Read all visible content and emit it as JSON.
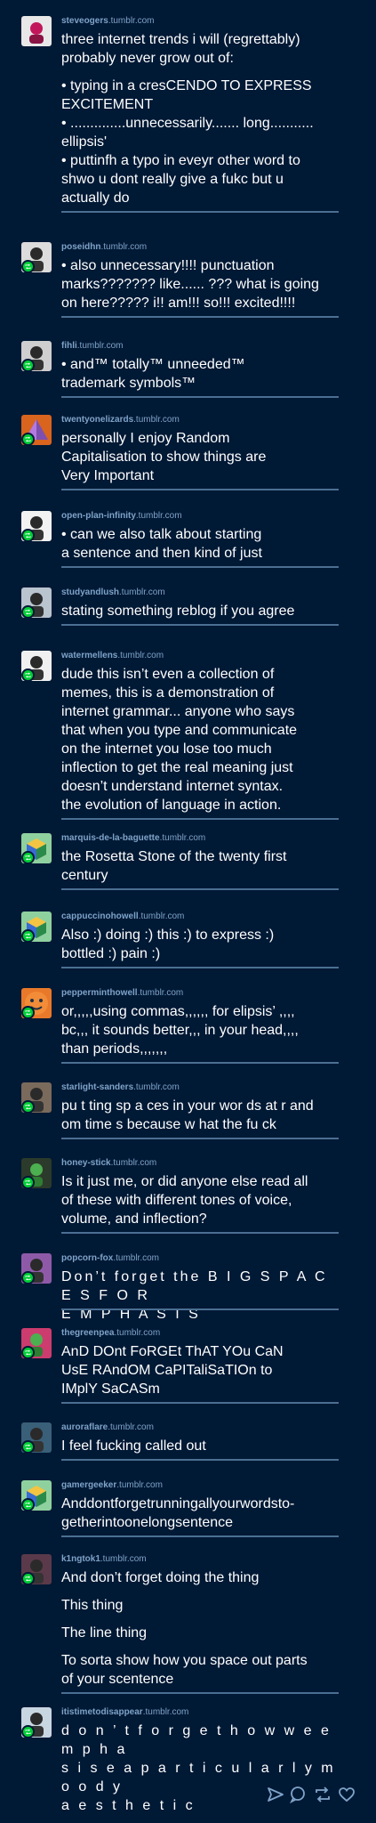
{
  "colors": {
    "background": "#001935",
    "username": "#7fa3c9",
    "text": "#ffffff",
    "separator": "#4b6f92",
    "reblog_badge": "#00cf35",
    "toolbar_icon": "#7fa3c9"
  },
  "posts": [
    {
      "user": "steveogers",
      "lines": [
        "three internet trends i will (regrettably)",
        "probably never grow out of:",
        "",
        "• typing in a cresCENDO TO EXPRESS",
        "EXCITEMENT",
        "• ..............unnecessarily....... long...........",
        "ellipsis'",
        "• puttinfh a typo in eveyr other word to",
        "shwo u dont really give a fukc but u",
        "actually do"
      ]
    },
    {
      "user": "poseidhn",
      "lines": [
        "• also unnecessary!!!! punctuation",
        "marks??????? like...... ??? what is going",
        "on here????? i!! am!!! so!!! excited!!!!"
      ]
    },
    {
      "user": "fihli",
      "lines": [
        "• and™ totally™ unneeded™",
        "trademark symbols™"
      ]
    },
    {
      "user": "twentyonelizards",
      "lines": [
        "personally I enjoy Random",
        "Capitalisation to show things are",
        "Very Important"
      ]
    },
    {
      "user": "open-plan-infinity",
      "lines": [
        "• can we also talk about starting",
        "a sentence and then kind of just"
      ]
    },
    {
      "user": "studyandlush",
      "lines": [
        "stating something reblog if you agree"
      ]
    },
    {
      "user": "watermellens",
      "lines": [
        "dude this isn’t even a collection of",
        "memes, this is a demonstration of",
        "internet grammar... anyone who says",
        "that when you type and communicate",
        "on the internet you lose too much",
        "inflection to get the real meaning just",
        "doesn’t understand internet syntax.",
        "the evolution of language in action."
      ]
    },
    {
      "user": "marquis-de-la-baguette",
      "lines": [
        "the Rosetta Stone of the twenty first",
        "century"
      ]
    },
    {
      "user": "cappuccinohowell",
      "lines": [
        "Also :) doing :) this :) to express :)",
        "bottled :) pain :)"
      ]
    },
    {
      "user": "pepperminthowell",
      "lines": [
        "or,,,,,using commas,,,,,, for elipsis’ ,,,,",
        "bc,,, it sounds better,,, in your head,,,,",
        "than periods,,,,,,,"
      ]
    },
    {
      "user": "starlight-sanders",
      "lines": [
        "pu t ting sp a ces in your wor ds at r and",
        "om time s because w hat the fu ck"
      ]
    },
    {
      "user": "honey-stick",
      "lines": [
        "Is it just me, or did anyone else read all",
        "of these with different tones of voice,",
        "volume, and inflection?"
      ]
    },
    {
      "user": "popcorn-fox",
      "lines": [
        "Don’t forget the B I G S P A C E S F O R",
        "E M P H A S I S"
      ]
    },
    {
      "user": "thegreenpea",
      "lines": [
        "AnD DOnt FoRGEt ThAT YOu CaN",
        "UsE RAndOM CaPITaliSaTIOn to",
        "IMplY SaCASm"
      ]
    },
    {
      "user": "auroraflare",
      "lines": [
        "I feel fucking called out"
      ]
    },
    {
      "user": "gamergeeker",
      "lines": [
        "Anddontforgetrunningallyourwordsto-",
        "getherintoonelongsentence"
      ]
    },
    {
      "user": "k1ngtok1",
      "lines": [
        "And don’t forget doing the thing",
        "",
        "This thing",
        "",
        "The line thing",
        "",
        "To sorta show how you space out parts",
        "of your scentence"
      ]
    },
    {
      "user": "itistimetodisappear",
      "lines": [
        "d o n ’ t   f o r g e t   h o w   w e   e m p h a",
        "s i s e   a   p a r t i c u l a r l y   m o o d y",
        "a e s t h e t i c"
      ]
    }
  ],
  "domain_suffix": ".tumblr.com",
  "toolbar": {
    "icons": [
      "share-icon",
      "reply-icon",
      "reblog-icon",
      "like-icon"
    ]
  }
}
